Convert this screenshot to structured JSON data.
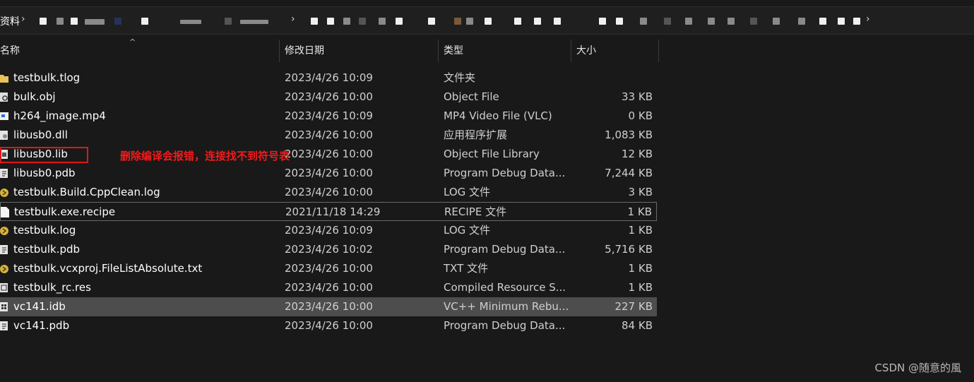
{
  "breadcrumb": {
    "root": "资料",
    "separator": "›"
  },
  "columns": {
    "name": "名称",
    "date": "修改日期",
    "type": "类型",
    "size": "大小"
  },
  "files": [
    {
      "name": "testbulk.tlog",
      "date": "2023/4/26 10:09",
      "type": "文件夹",
      "size": "",
      "icon": "folder-icon"
    },
    {
      "name": "bulk.obj",
      "date": "2023/4/26 10:00",
      "type": "Object File",
      "size": "33 KB",
      "icon": "object-file-icon"
    },
    {
      "name": "h264_image.mp4",
      "date": "2023/4/26 10:09",
      "type": "MP4 Video File (VLC)",
      "size": "0 KB",
      "icon": "video-file-icon"
    },
    {
      "name": "libusb0.dll",
      "date": "2023/4/26 10:00",
      "type": "应用程序扩展",
      "size": "1,083 KB",
      "icon": "dll-file-icon"
    },
    {
      "name": "libusb0.lib",
      "date": "2023/4/26 10:00",
      "type": "Object File Library",
      "size": "12 KB",
      "icon": "lib-file-icon"
    },
    {
      "name": "libusb0.pdb",
      "date": "2023/4/26 10:00",
      "type": "Program Debug Data...",
      "size": "7,244 KB",
      "icon": "pdb-file-icon"
    },
    {
      "name": "testbulk.Build.CppClean.log",
      "date": "2023/4/26 10:00",
      "type": "LOG 文件",
      "size": "3 KB",
      "icon": "log-file-icon"
    },
    {
      "name": "testbulk.exe.recipe",
      "date": "2021/11/18 14:29",
      "type": "RECIPE 文件",
      "size": "1 KB",
      "icon": "blank-file-icon"
    },
    {
      "name": "testbulk.log",
      "date": "2023/4/26 10:09",
      "type": "LOG 文件",
      "size": "1 KB",
      "icon": "log-file-icon"
    },
    {
      "name": "testbulk.pdb",
      "date": "2023/4/26 10:02",
      "type": "Program Debug Data...",
      "size": "5,716 KB",
      "icon": "pdb-file-icon"
    },
    {
      "name": "testbulk.vcxproj.FileListAbsolute.txt",
      "date": "2023/4/26 10:00",
      "type": "TXT 文件",
      "size": "1 KB",
      "icon": "log-file-icon"
    },
    {
      "name": "testbulk_rc.res",
      "date": "2023/4/26 10:00",
      "type": "Compiled Resource S...",
      "size": "1 KB",
      "icon": "res-file-icon"
    },
    {
      "name": "vc141.idb",
      "date": "2023/4/26 10:00",
      "type": "VC++ Minimum Rebu...",
      "size": "227 KB",
      "icon": "idb-file-icon"
    },
    {
      "name": "vc141.pdb",
      "date": "2023/4/26 10:00",
      "type": "Program Debug Data...",
      "size": "84 KB",
      "icon": "pdb-file-icon"
    }
  ],
  "annotation": {
    "text": "删除编译会报错，连接找不到符号表",
    "color": "#f21b1b"
  },
  "watermark": "CSDN @随意的風"
}
